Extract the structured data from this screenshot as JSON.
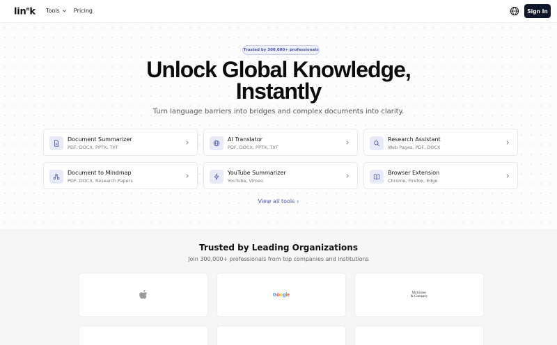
{
  "nav": {
    "logo_main": "lin",
    "logo_sup": "n",
    "logo_end": "k",
    "tools_label": "Tools",
    "pricing_label": "Pricing",
    "signin_label": "Sign In"
  },
  "hero": {
    "badge": "Trusted by 300,000+ professionals",
    "headline_line1": "Unlock Global Knowledge,",
    "headline_line2": "Instantly",
    "subhead": "Turn language barriers into bridges and complex documents into clarity."
  },
  "tools": [
    {
      "title": "Document Summarizer",
      "subtitle": "PDF, DOCX, PPTX, TXT",
      "icon": "document-icon"
    },
    {
      "title": "AI Translator",
      "subtitle": "PDF, DOCX, PPTX, TXT",
      "icon": "globe-icon"
    },
    {
      "title": "Research Assistant",
      "subtitle": "Web Pages, PDF, DOCX",
      "icon": "search-icon"
    },
    {
      "title": "Document to Mindmap",
      "subtitle": "PDF, DOCX, Research Papers",
      "icon": "mindmap-icon"
    },
    {
      "title": "YouTube Summarizer",
      "subtitle": "YouTube, Vimeo",
      "icon": "lightning-icon"
    },
    {
      "title": "Browser Extension",
      "subtitle": "Chrome, Firefox, Edge",
      "icon": "book-icon"
    }
  ],
  "view_all": "View all tools",
  "trusted": {
    "title": "Trusted by Leading Organizations",
    "subtitle": "Join 300,000+ professionals from top companies and institutions",
    "logos": [
      {
        "name": "apple-logo"
      },
      {
        "name": "google-logo",
        "text": "Google"
      },
      {
        "name": "mckinsey-logo",
        "line1": "McKinsey",
        "line2": "& Company"
      }
    ]
  },
  "colors": {
    "accent": "#4a56a6",
    "icon_bg": "#e8eaf8",
    "signin_bg": "#0f172a"
  }
}
